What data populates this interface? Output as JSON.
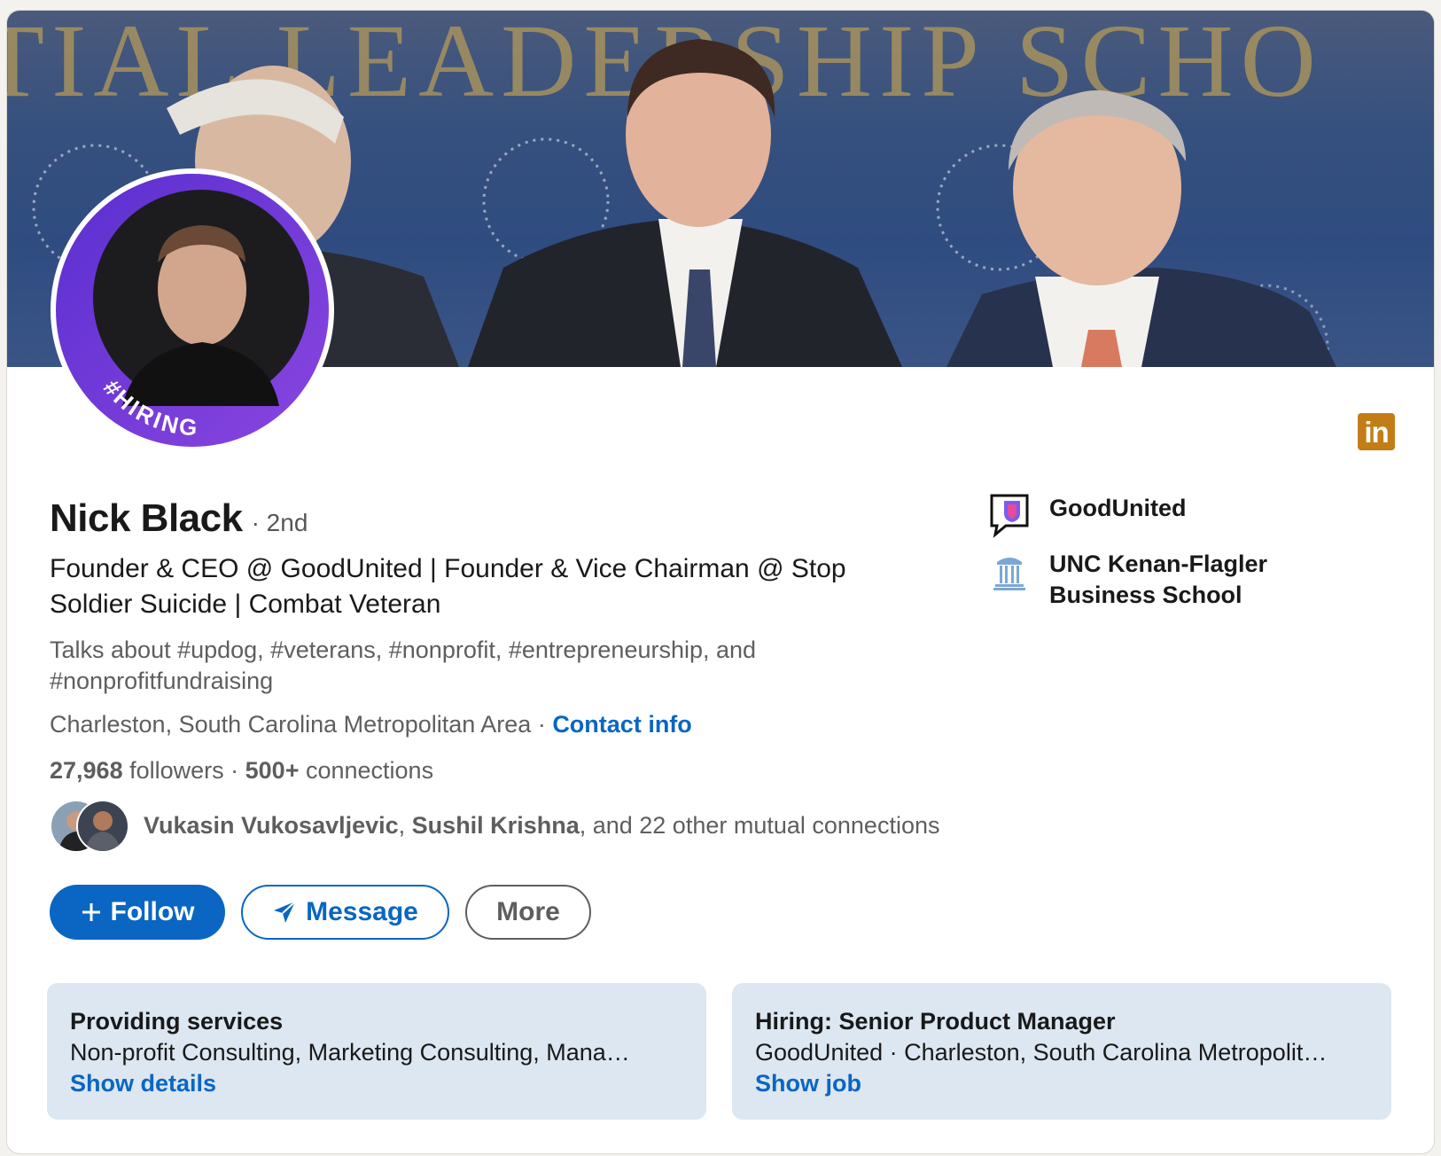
{
  "profile": {
    "name": "Nick Black",
    "degree": "· 2nd",
    "headline": "Founder & CEO @ GoodUnited | Founder & Vice Chairman @ Stop Soldier Suicide | Combat Veteran",
    "talks_about": "Talks about #updog, #veterans, #nonprofit, #entrepreneurship, and #nonprofitfundraising",
    "location": "Charleston, South Carolina Metropolitan Area",
    "location_sep": " · ",
    "contact_info_label": "Contact info",
    "followers_count": "27,968",
    "followers_label": " followers",
    "connections_sep": "  · ",
    "connections_count": "500+",
    "connections_label": " connections",
    "hiring_frame_text": "#HIRING",
    "banner_text": "TIAL LEADERSHIP SCHO"
  },
  "mutual": {
    "name1": "Vukasin Vukosavljevic",
    "sep": ", ",
    "name2": "Sushil Krishna",
    "rest": ", and 22 other mutual connections"
  },
  "actions": {
    "follow_label": "Follow",
    "message_label": "Message",
    "more_label": "More"
  },
  "experience": [
    {
      "name": "GoodUnited",
      "icon": "goodunited-logo"
    },
    {
      "name": "UNC Kenan-Flagler Business School",
      "icon": "unc-logo"
    }
  ],
  "info_boxes": [
    {
      "title": "Providing services",
      "desc": "Non-profit Consulting, Marketing Consulting, Mana…",
      "link": "Show details"
    },
    {
      "title": "Hiring: Senior Product Manager",
      "desc": "GoodUnited · Charleston, South Carolina Metropolit…",
      "link": "Show job"
    }
  ],
  "badges": {
    "linkedin_text": "in"
  },
  "colors": {
    "primary_blue": "#0a66c2",
    "hiring_purple": "#7a3fd6",
    "linkedin_badge": "#c37d16",
    "info_box_bg": "#dde7f1"
  }
}
